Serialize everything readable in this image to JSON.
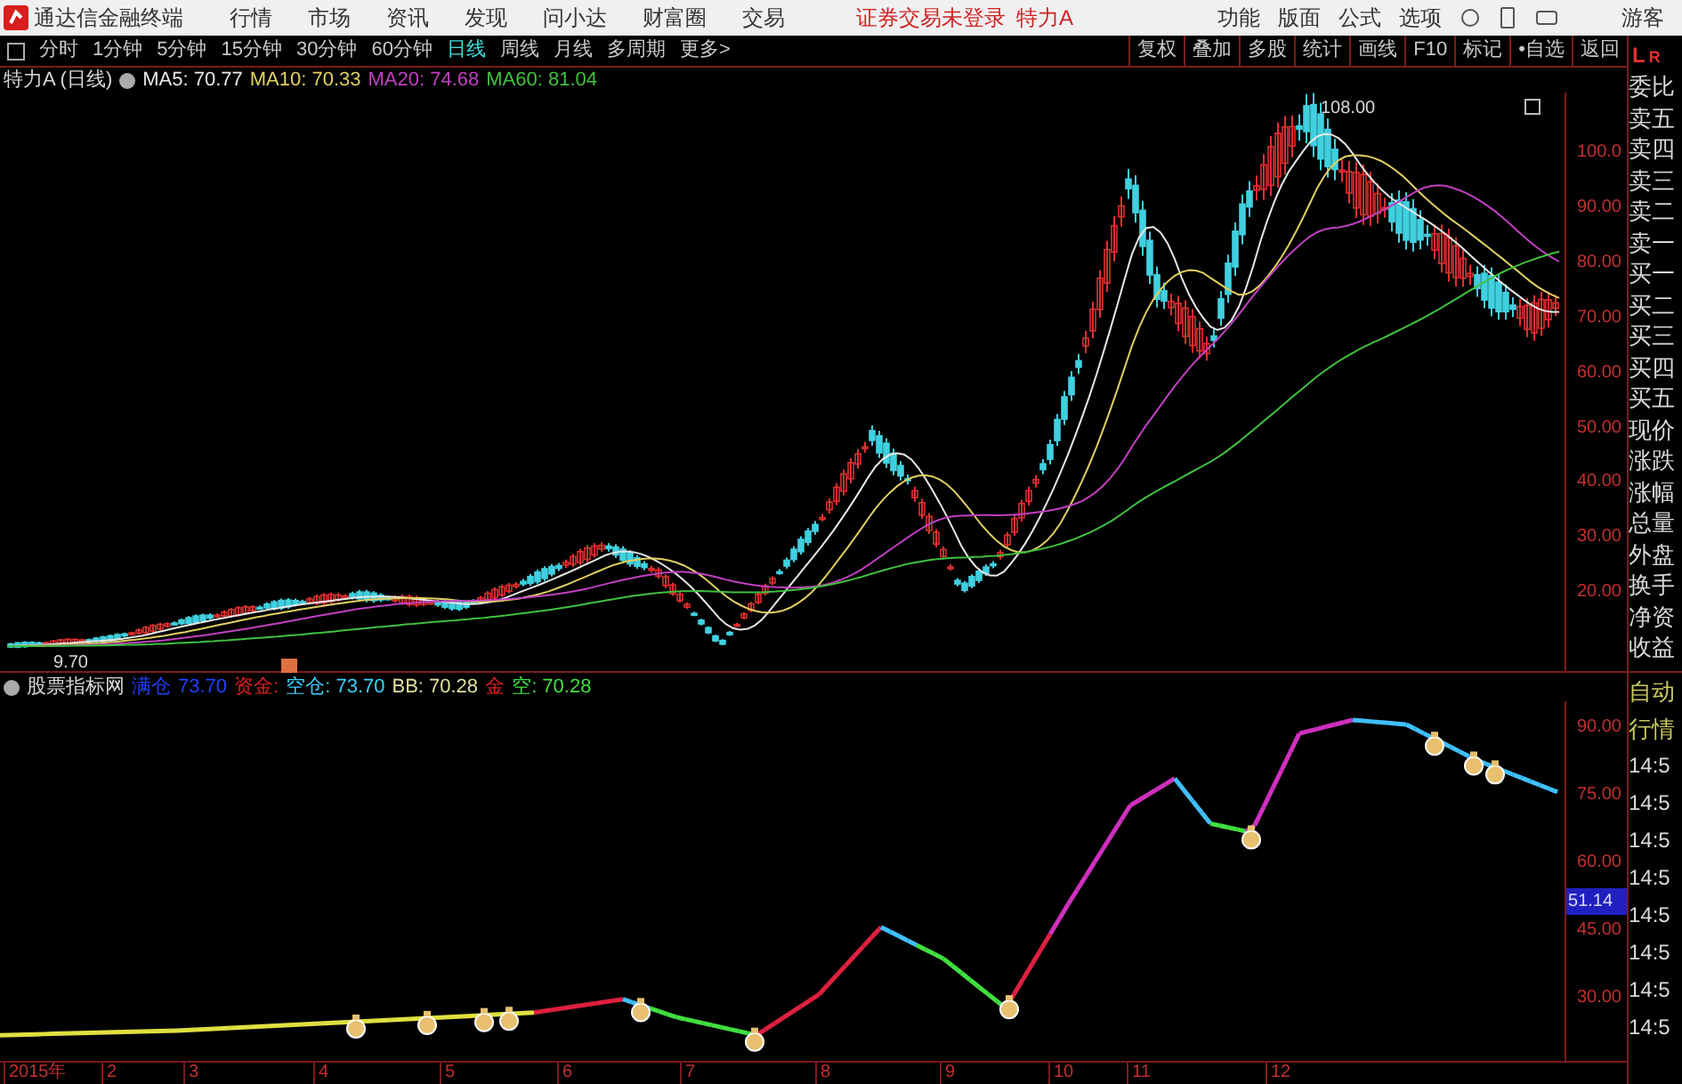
{
  "title_bar": {
    "app_name": "通达信金融终端",
    "menus": [
      "行情",
      "市场",
      "资讯",
      "发现",
      "问小达",
      "财富圈",
      "交易"
    ],
    "notice": "证券交易未登录",
    "stock": "特力A",
    "tools": [
      "功能",
      "版面",
      "公式",
      "选项"
    ],
    "user": "游客"
  },
  "toolbar": {
    "periods": [
      {
        "label": "分时",
        "selected": false
      },
      {
        "label": "1分钟",
        "selected": false
      },
      {
        "label": "5分钟",
        "selected": false
      },
      {
        "label": "15分钟",
        "selected": false
      },
      {
        "label": "30分钟",
        "selected": false
      },
      {
        "label": "60分钟",
        "selected": false
      },
      {
        "label": "日线",
        "selected": true
      },
      {
        "label": "周线",
        "selected": false
      },
      {
        "label": "月线",
        "selected": false
      },
      {
        "label": "多周期",
        "selected": false
      },
      {
        "label": "更多>",
        "selected": false
      }
    ],
    "actions": [
      "复权",
      "叠加",
      "多股",
      "统计",
      "画线",
      "F10",
      "标记",
      "•自选",
      "返回"
    ],
    "corner": [
      "L",
      "R"
    ]
  },
  "price_chart": {
    "legend_title": "特力A (日线)",
    "indicators": [
      {
        "label": "MA5: 70.77",
        "color": "#e8e8e8"
      },
      {
        "label": "MA10: 70.33",
        "color": "#e0d060"
      },
      {
        "label": "MA20: 74.68",
        "color": "#c040c0"
      },
      {
        "label": "MA60: 81.04",
        "color": "#40c040"
      }
    ],
    "high_label": "108.00",
    "low_label": "9.70",
    "axis_labels": [
      "100.0",
      "90.00",
      "80.00",
      "70.00",
      "60.00",
      "50.00",
      "40.00",
      "30.00",
      "20.00"
    ]
  },
  "quote_labels": [
    "委比",
    "卖五",
    "卖四",
    "卖三",
    "卖二",
    "卖一",
    "买一",
    "买二",
    "买三",
    "买四",
    "买五",
    "现价",
    "涨跌",
    "涨幅",
    "总量",
    "外盘",
    "换手",
    "净资",
    "收益"
  ],
  "indicator_panel": {
    "title": "股票指标网",
    "items": [
      {
        "label": "满仓",
        "color": "#2040ff"
      },
      {
        "label": "73.70",
        "color": "#2040ff"
      },
      {
        "label": "资金:",
        "color": "#e02020"
      },
      {
        "label": "空仓: 73.70",
        "color": "#40d0ff"
      },
      {
        "label": "BB: 70.28",
        "color": "#e0e0a0"
      },
      {
        "label": "金",
        "color": "#e02020"
      },
      {
        "label": "空: 70.28",
        "color": "#40e040"
      }
    ],
    "axis_labels": [
      "90.00",
      "75.00",
      "60.00",
      "45.00",
      "30.00"
    ],
    "current": "51.14"
  },
  "side_tabs": [
    "自动",
    "行情"
  ],
  "ticks": [
    "14:5",
    "14:5",
    "14:5",
    "14:5",
    "14:5",
    "14:5",
    "14:5",
    "14:5"
  ],
  "x_axis": [
    "2015年",
    "2",
    "3",
    "4",
    "5",
    "6",
    "7",
    "8",
    "9",
    "10",
    "11",
    "12"
  ]
}
